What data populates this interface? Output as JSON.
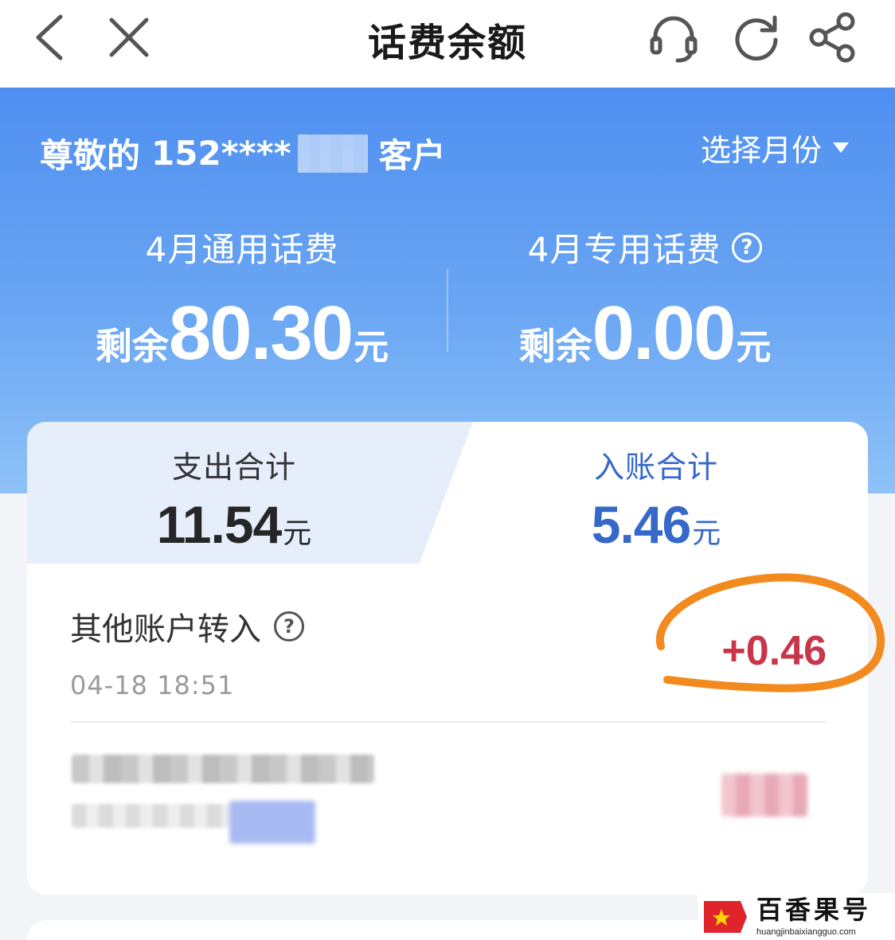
{
  "header": {
    "title": "话费余额",
    "icons": [
      "back-icon",
      "close-icon",
      "headset-icon",
      "refresh-icon",
      "share-icon"
    ]
  },
  "hero": {
    "greeting_prefix": "尊敬的",
    "phone_masked": "152****",
    "greeting_suffix": "客户",
    "month_select_label": "选择月份",
    "general": {
      "label": "4月通用话费",
      "prefix": "剩余",
      "amount": "80.30",
      "unit": "元"
    },
    "special": {
      "label": "4月专用话费",
      "prefix": "剩余",
      "amount": "0.00",
      "unit": "元"
    }
  },
  "tabs": {
    "expense": {
      "label": "支出合计",
      "amount": "11.54",
      "unit": "元"
    },
    "income": {
      "label": "入账合计",
      "amount": "5.46",
      "unit": "元"
    }
  },
  "records": [
    {
      "title": "其他账户转入",
      "time": "04-18 18:51",
      "amount": "+0.46"
    }
  ],
  "watermark": {
    "name": "百香果号",
    "url": "huangjinbaixiangguo.com"
  },
  "colors": {
    "primary_blue": "#4f8ff0",
    "income_blue": "#3568c9",
    "amount_red": "#c8364a",
    "annotation_orange": "#f28a1e"
  }
}
